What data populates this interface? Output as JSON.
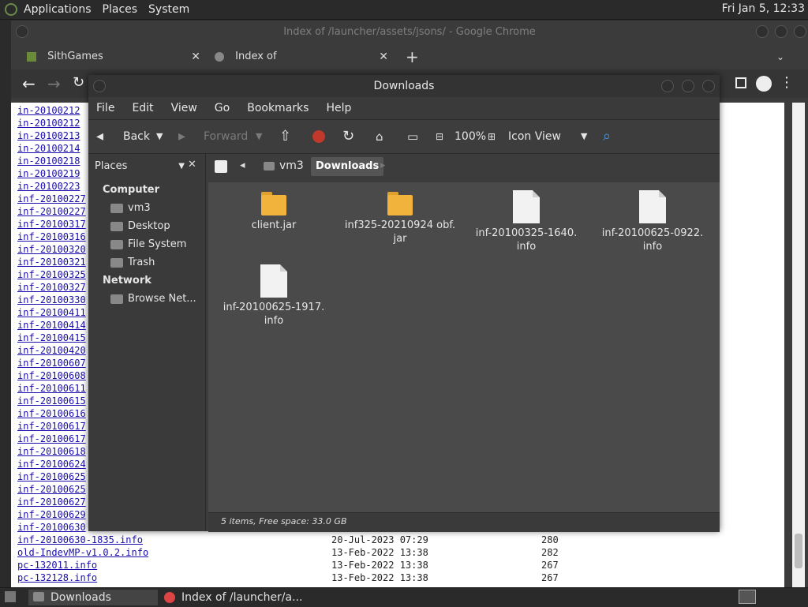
{
  "top_panel": {
    "applications": "Applications",
    "places": "Places",
    "system": "System",
    "clock": "Fri Jan  5, 12:33"
  },
  "chrome": {
    "title": "Index of /launcher/assets/jsons/ - Google Chrome",
    "tabs": [
      {
        "label": "SithGames"
      },
      {
        "label": "Index of /launcher/assets/json"
      }
    ],
    "new_tab": "+"
  },
  "page": {
    "links": [
      "in-20100212",
      "in-20100212",
      "in-20100213",
      "in-20100214",
      "in-20100218",
      "in-20100219",
      "in-20100223",
      "inf-20100227",
      "inf-20100227",
      "inf-20100317",
      "inf-20100316",
      "inf-20100320",
      "inf-20100321",
      "inf-20100325",
      "inf-20100327",
      "inf-20100330",
      "inf-20100411",
      "inf-20100414",
      "inf-20100415",
      "inf-20100420",
      "inf-20100607",
      "inf-20100608",
      "inf-20100611",
      "inf-20100615",
      "inf-20100616",
      "inf-20100617",
      "inf-20100617",
      "inf-20100618",
      "inf-20100624",
      "inf-20100625",
      "inf-20100625",
      "inf-20100627",
      "inf-20100629",
      "inf-20100630"
    ],
    "rows": [
      {
        "name": "inf-20100630-1835.info",
        "date": "20-Jul-2023 07:29",
        "size": "280"
      },
      {
        "name": "old-IndevMP-v1.0.2.info",
        "date": "13-Feb-2022 13:38",
        "size": "282"
      },
      {
        "name": "pc-132011.info",
        "date": "13-Feb-2022 13:38",
        "size": "267"
      },
      {
        "name": "pc-132128.info",
        "date": "13-Feb-2022 13:38",
        "size": "267"
      }
    ]
  },
  "fm": {
    "title": "Downloads",
    "menu": [
      "File",
      "Edit",
      "View",
      "Go",
      "Bookmarks",
      "Help"
    ],
    "toolbar": {
      "back": "Back",
      "forward": "Forward",
      "zoom": "100%",
      "view": "Icon View"
    },
    "sidebar": {
      "dropdown": "Places",
      "computer": "Computer",
      "computer_items": [
        "vm3",
        "Desktop",
        "File System",
        "Trash"
      ],
      "network": "Network",
      "network_items": [
        "Browse Net..."
      ]
    },
    "path": [
      "vm3",
      "Downloads"
    ],
    "files": [
      {
        "line1": "client.jar",
        "line2": "",
        "kind": "folder"
      },
      {
        "line1": "inf325-20210924 obf.",
        "line2": "jar",
        "kind": "folder"
      },
      {
        "line1": "inf-20100325-1640.",
        "line2": "info",
        "kind": "doc"
      },
      {
        "line1": "inf-20100625-0922.",
        "line2": "info",
        "kind": "doc"
      },
      {
        "line1": "inf-20100625-1917.",
        "line2": "info",
        "kind": "doc"
      }
    ],
    "status": "5 items, Free space: 33.0 GB"
  },
  "taskbar": {
    "items": [
      {
        "label": "Downloads"
      },
      {
        "label": "Index of /launcher/a..."
      }
    ]
  }
}
